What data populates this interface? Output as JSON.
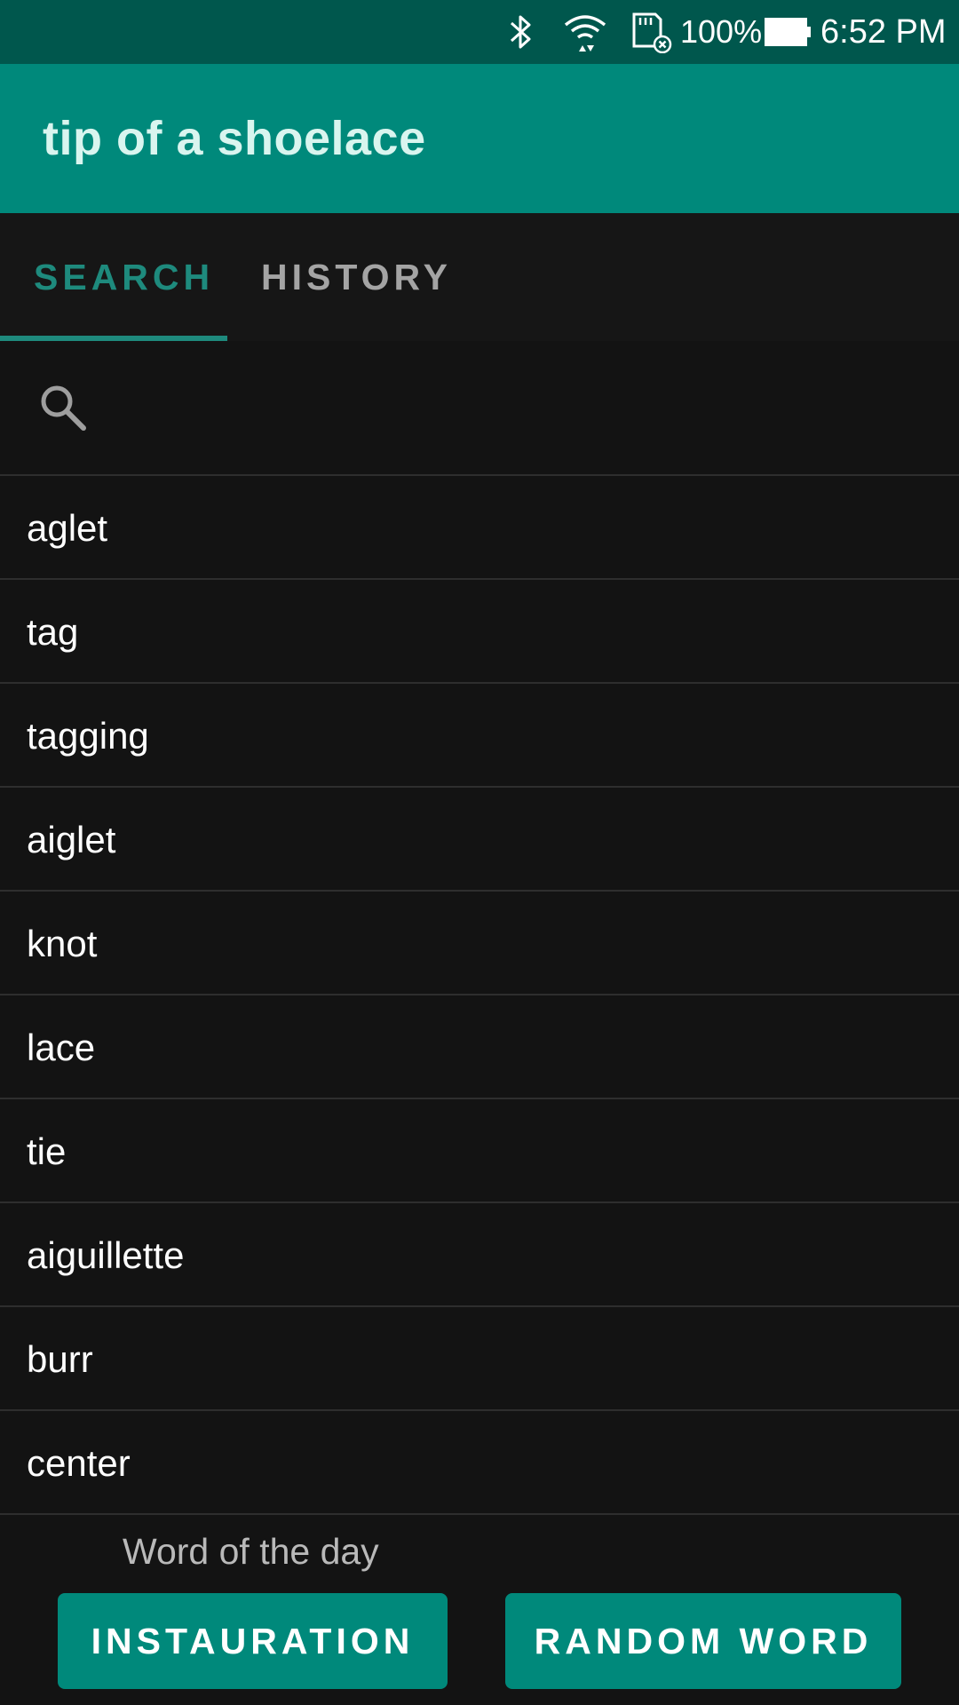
{
  "status_bar": {
    "battery_percent": "100%",
    "time": "6:52 PM",
    "icons": [
      "bluetooth-icon",
      "wifi-icon",
      "sd-card-icon",
      "battery-icon"
    ]
  },
  "app_bar": {
    "title": "tip of a shoelace",
    "color": "#00897b"
  },
  "tabs": [
    {
      "label": "SEARCH",
      "selected": true
    },
    {
      "label": "HISTORY",
      "selected": false
    }
  ],
  "search": {
    "icon": "search-icon",
    "value": "",
    "placeholder": ""
  },
  "words": [
    "aglet",
    "tag",
    "tagging",
    "aiglet",
    "knot",
    "lace",
    "tie",
    "aiguillette",
    "burr",
    "center"
  ],
  "footer": {
    "word_of_day_label": "Word of the day",
    "word_of_day_button": "INSTAURATION",
    "random_word_button": "RANDOM WORD"
  },
  "colors": {
    "accent": "#1e8a7d",
    "status_bar": "#00574d",
    "background": "#131313"
  }
}
